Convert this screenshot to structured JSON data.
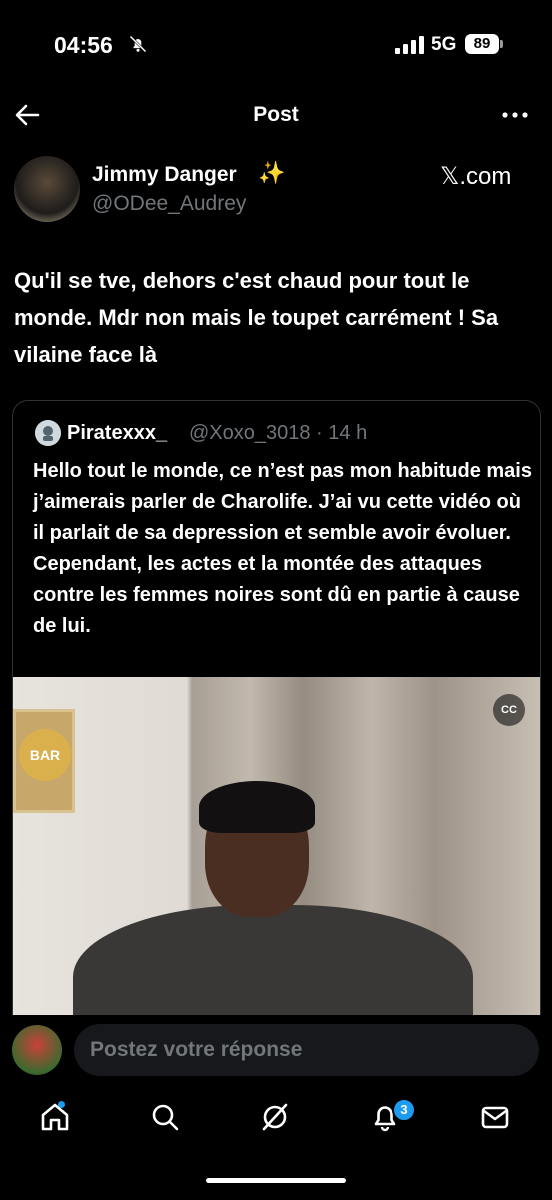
{
  "status_bar": {
    "time": "04:56",
    "network": "5G",
    "battery": "89"
  },
  "header": {
    "title": "Post"
  },
  "post": {
    "display_name": "Jimmy Danger",
    "sparkle": "✨",
    "handle": "@ODee_Audrey",
    "source": "𝕏.com",
    "text": "Qu'il se tve, dehors c'est chaud pour tout le monde. Mdr non mais le toupet carrément ! Sa vilaine face là"
  },
  "quote": {
    "name": "Piratexxx_",
    "handle_time": "@Xoxo_3018 · 14 h",
    "text": "Hello tout le monde, ce n’est pas mon habitude mais j’aimerais parler de Charolife. J’ai vu cette vidéo où il parlait de sa depression et semble avoir évoluer. Cependant, les actes et la montée des attaques contre les femmes noires sont dû en partie à cause de lui.",
    "video_cc": "CC",
    "video_sign": "BAR"
  },
  "reply": {
    "placeholder": "Postez votre réponse"
  },
  "tabbar": {
    "notifications_badge": "3"
  },
  "colors": {
    "accent": "#1d9bf0",
    "background": "#000000",
    "muted": "#71767b"
  }
}
